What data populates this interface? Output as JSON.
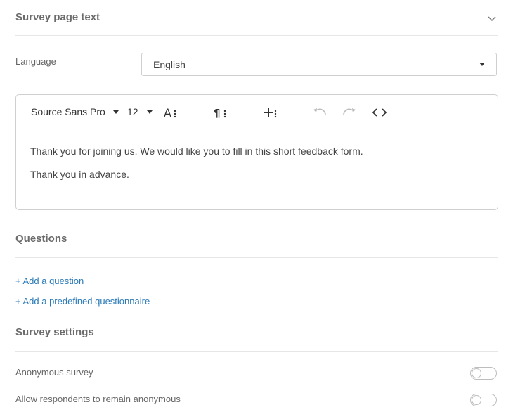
{
  "page_text": {
    "title": "Survey page text",
    "language_label": "Language",
    "language_value": "English"
  },
  "editor": {
    "font_family": "Source Sans Pro",
    "font_size": "12",
    "paragraph_1": "Thank you for joining us. We would like you to fill in this short feedback form.",
    "paragraph_2": "Thank you in advance."
  },
  "questions": {
    "title": "Questions",
    "add_question": "+ Add a question",
    "add_predefined": "+ Add a predefined questionnaire"
  },
  "settings": {
    "title": "Survey settings",
    "anonymous_label": "Anonymous survey",
    "anonymous_on": false,
    "allow_anonymous_label": "Allow respondents to remain anonymous",
    "allow_anonymous_on": false
  }
}
